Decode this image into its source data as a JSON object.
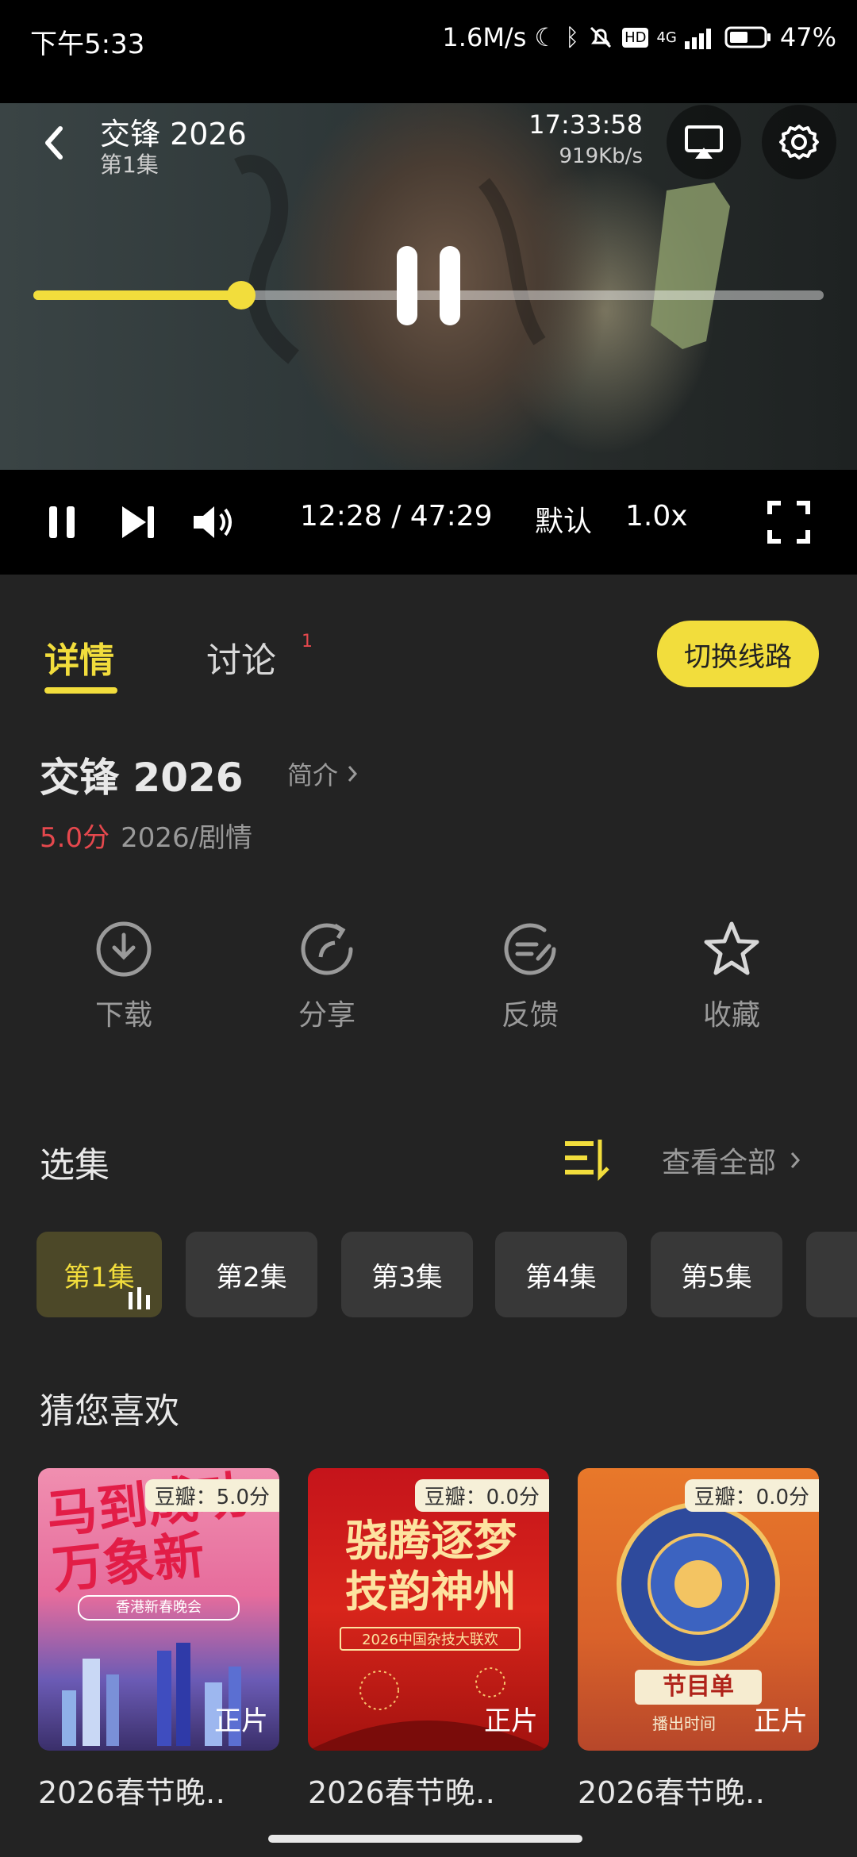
{
  "status_bar": {
    "time": "下午5:33",
    "net_speed": "1.6M/s",
    "network": "4G",
    "battery": "47%"
  },
  "player": {
    "title": "交锋 2026",
    "episode": "第1集",
    "clock": "17:33:58",
    "bitrate": "919Kb/s",
    "progress": 0.263,
    "time_display": "12:28 / 47:29",
    "quality": "默认",
    "speed": "1.0x"
  },
  "tabs": {
    "details": "详情",
    "discuss": "讨论",
    "discuss_badge": "1",
    "switch_line": "切换线路"
  },
  "info": {
    "title": "交锋 2026",
    "intro_link": "简介",
    "score": "5.0分",
    "meta": "2026/剧情"
  },
  "actions": {
    "download": "下载",
    "share": "分享",
    "feedback": "反馈",
    "favorite": "收藏"
  },
  "episodes": {
    "heading": "选集",
    "view_all": "查看全部",
    "items": [
      "第1集",
      "第2集",
      "第3集",
      "第4集",
      "第5集"
    ]
  },
  "recommend": {
    "heading": "猜您喜欢",
    "cards": [
      {
        "score": "豆瓣：5.0分",
        "tag": "正片",
        "title": "2026春节晚‥",
        "poster_text": "马到成功 万象新",
        "poster_sub": "香港新春晚会"
      },
      {
        "score": "豆瓣：0.0分",
        "tag": "正片",
        "title": "2026春节晚‥",
        "poster_text": "骁腾逐梦 技韵神州",
        "poster_sub": "2026中国杂技大联欢"
      },
      {
        "score": "豆瓣：0.0分",
        "tag": "正片",
        "title": "2026春节晚‥",
        "poster_text": "节目单",
        "poster_sub": "播出时间"
      }
    ]
  },
  "colors": {
    "accent": "#f2dd3c",
    "score_red": "#e5484d",
    "bg": "#232323"
  }
}
